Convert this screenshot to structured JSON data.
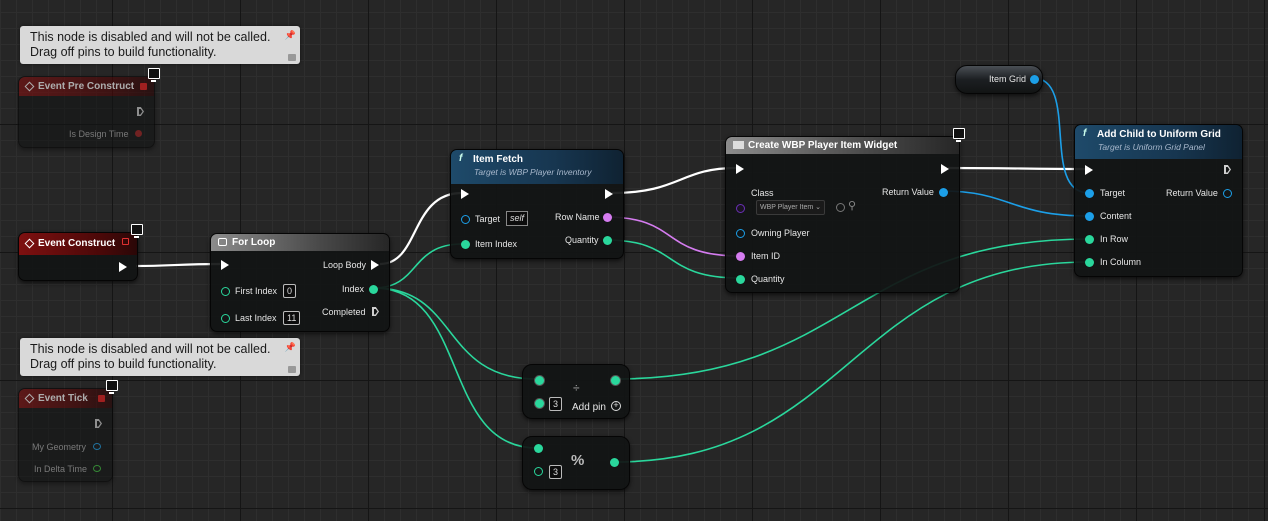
{
  "disabled_comment": {
    "line1": "This node is disabled and will not be called.",
    "line2": "Drag off pins to build functionality."
  },
  "event_pre_construct": {
    "title": "Event Pre Construct",
    "pin_is_design_time": "Is Design Time"
  },
  "event_construct": {
    "title": "Event Construct"
  },
  "event_tick": {
    "title": "Event Tick",
    "pin_my_geometry": "My Geometry",
    "pin_in_delta_time": "In Delta Time"
  },
  "for_loop": {
    "title": "For Loop",
    "pin_first_index": "First Index",
    "first_index_value": "0",
    "pin_last_index": "Last Index",
    "last_index_value": "11",
    "pin_loop_body": "Loop Body",
    "pin_index": "Index",
    "pin_completed": "Completed"
  },
  "item_fetch": {
    "title": "Item Fetch",
    "subtitle": "Target is WBP Player Inventory",
    "pin_target": "Target",
    "target_value": "self",
    "pin_item_index": "Item Index",
    "pin_row_name": "Row Name",
    "pin_quantity": "Quantity"
  },
  "create_widget": {
    "title": "Create WBP Player Item Widget",
    "pin_class": "Class",
    "class_value": "WBP Player Item",
    "pin_owning_player": "Owning Player",
    "pin_item_id": "Item ID",
    "pin_quantity": "Quantity",
    "pin_return_value": "Return Value"
  },
  "item_grid": {
    "label": "Item Grid"
  },
  "add_child": {
    "title": "Add Child to Uniform Grid",
    "subtitle": "Target is Uniform Grid Panel",
    "pin_target": "Target",
    "pin_content": "Content",
    "pin_in_row": "In Row",
    "pin_in_column": "In Column",
    "pin_return_value": "Return Value"
  },
  "divide_node": {
    "symbol": "÷",
    "value": "3",
    "add_pin": "Add pin"
  },
  "modulo_node": {
    "symbol": "%",
    "value": "3"
  },
  "colors": {
    "exec": "#ffffff",
    "int": "#2ad79c",
    "object": "#1c9fe8",
    "name": "#d57cf0",
    "event_red": "#7e1010"
  }
}
